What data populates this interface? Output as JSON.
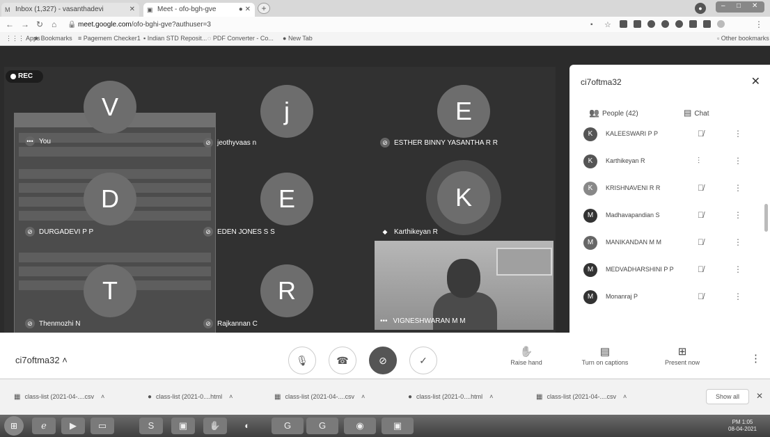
{
  "browser": {
    "tabs": [
      {
        "label": "Inbox (1,327) - vasanthadevi",
        "icon": "gmail-icon"
      },
      {
        "label": "Meet - ofo-bgh-gve",
        "icon": "meet-icon"
      }
    ],
    "url_prefix": "meet.google.com",
    "url_rest": "/ofo-bghi-gve?authuser=3",
    "bookmarks": [
      "Apps",
      "Bookmarks",
      "Pagemem Checker1",
      "Indian STD Reposit...",
      "PDF Converter - Co...",
      "New Tab"
    ],
    "other_bookmarks": "Other bookmarks"
  },
  "meeting": {
    "rec_label": "REC",
    "code": "ci7oftma32",
    "tiles": [
      {
        "initial": "V",
        "name": "You"
      },
      {
        "initial": "j",
        "name": "jeothyvaas n"
      },
      {
        "initial": "E",
        "name": "ESTHER BINNY YASANTHA R R"
      },
      {
        "initial": "D",
        "name": "DURGADEVI P P"
      },
      {
        "initial": "E",
        "name": "EDEN JONES S S"
      },
      {
        "initial": "K",
        "name": "Karthikeyan R"
      },
      {
        "initial": "T",
        "name": "Thenmozhi N"
      },
      {
        "initial": "R",
        "name": "Rajkannan C"
      }
    ],
    "video_name": "VIGNESHWARAN M M",
    "actions": {
      "raise_hand": "Raise hand",
      "captions": "Turn on captions",
      "present": "Present now"
    }
  },
  "panel": {
    "title": "ci7oftma32",
    "people_tab": "People (42)",
    "chat_tab": "Chat",
    "people": [
      {
        "initial": "K",
        "name": "KALEESWARI P P"
      },
      {
        "initial": "K",
        "name": "Karthikeyan R"
      },
      {
        "initial": "K",
        "name": "KRISHNAVENI R R"
      },
      {
        "initial": "M",
        "name": "Madhavapandian S"
      },
      {
        "initial": "M",
        "name": "MANIKANDAN M M"
      },
      {
        "initial": "M",
        "name": "MEDVADHARSHINI P P"
      },
      {
        "initial": "M",
        "name": "Monanraj P"
      }
    ]
  },
  "downloads": {
    "items": [
      "class-list (2021-04-....csv",
      "class-list (2021-0....html",
      "class-list (2021-04-....csv",
      "class-list (2021-0....html",
      "class-list (2021-04-....csv"
    ],
    "show_all": "Show all"
  },
  "taskbar": {
    "time": "PM 1:05",
    "date": "08-04-2021"
  }
}
